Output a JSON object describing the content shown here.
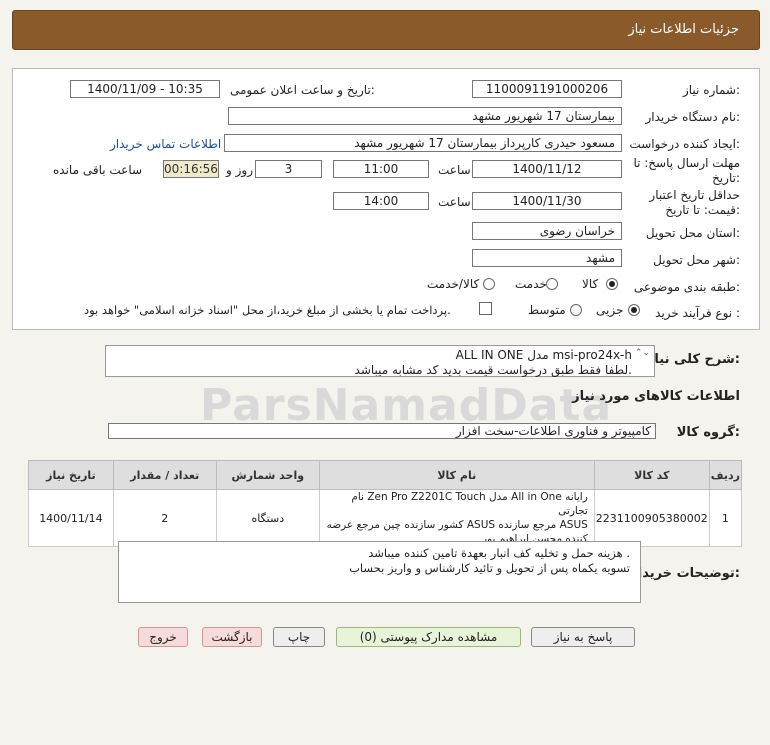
{
  "header": {
    "title": "جزئیات اطلاعات نیاز"
  },
  "form": {
    "need_number_label": "شماره نیاز:",
    "need_number": "1100091191000206",
    "announce_label": "تاریخ و ساعت اعلان عمومی:",
    "announce_value": "1400/11/09 - 10:35",
    "buyer_org_label": "نام دستگاه خریدار:",
    "buyer_org": "بیمارستان 17 شهریور مشهد",
    "creator_label": "ایجاد کننده درخواست:",
    "creator": "مسعود حیدری کارپرداز بیمارستان 17 شهریور مشهد",
    "contact_link": "اطلاعات تماس خریدار",
    "deadline_label_1": "مهلت ارسال پاسخ: تا",
    "deadline_label_2": "تاریخ:",
    "deadline_date": "1400/11/12",
    "time_label": "ساعت",
    "deadline_time": "11:00",
    "days_value": "3",
    "days_label": "روز و",
    "remaining_timer": "00:16:56",
    "remaining_label": "ساعت باقی مانده",
    "validity_label_1": "حداقل تاریخ اعتبار",
    "validity_label_2": "قیمت: تا تاریخ:",
    "validity_date": "1400/11/30",
    "validity_time_label": "ساعت",
    "validity_time": "14:00",
    "province_label": "استان محل تحویل:",
    "province": "خراسان رضوی",
    "city_label": "شهر محل تحویل:",
    "city": "مشهد",
    "category_label": "طبقه بندی موضوعی:",
    "category_options": [
      "کالا",
      "خدمت",
      "کالا/خدمت"
    ],
    "category_selected": "کالا",
    "process_label": "نوع فرآیند خرید :",
    "process_options": [
      "جزیی",
      "متوسط"
    ],
    "process_selected": "جزیی",
    "treasury_note": "پرداخت تمام یا بخشی از مبلغ خرید،از محل \"اسناد خزانه اسلامی\" خواهد بود."
  },
  "summary": {
    "label": "شرح کلی نیاز:",
    "line1": "ALL IN ONE مدل msi-pro24x-h",
    "line2": "لطفا فقط طبق درخواست قیمت بدید کد مشابه میباشد."
  },
  "goods_section": {
    "title": "اطلاعات کالاهای مورد نیاز",
    "group_label": "گروه کالا:",
    "group_value": "کامپیوتر و فناوری اطلاعات-سخت افزار"
  },
  "table": {
    "headers": [
      "ردیف",
      "کد کالا",
      "نام کالا",
      "واحد شمارش",
      "تعداد / مقدار",
      "تاریخ نیاز"
    ],
    "rows": [
      {
        "row": "1",
        "code": "2231100905380002",
        "name_line1": "رایانه All in One مدل Zen Pro Z2201C Touch نام تجارتی",
        "name_line2": "ASUS مرجع سازنده ASUS کشور سازنده چین مرجع عرضه",
        "name_line3": "کننده محسن ابراهیم پور",
        "unit": "دستگاه",
        "qty": "2",
        "date": "1400/11/14"
      }
    ]
  },
  "buyer_notes": {
    "label": "توضیحات خریدار:",
    "line1": "هزینه حمل و تخلیه کف انبار بعهدة تامین کننده میباشد .",
    "line2": "تسویه یکماه پس از تحویل و تائید کارشناس و واریز بحساب"
  },
  "buttons": {
    "reply": "پاسخ به نیاز",
    "attachments": "مشاهده مدارک پیوستی (0)",
    "print": "چاپ",
    "back": "بازگشت",
    "exit": "خروج"
  },
  "watermark": "ParsNamadData"
}
